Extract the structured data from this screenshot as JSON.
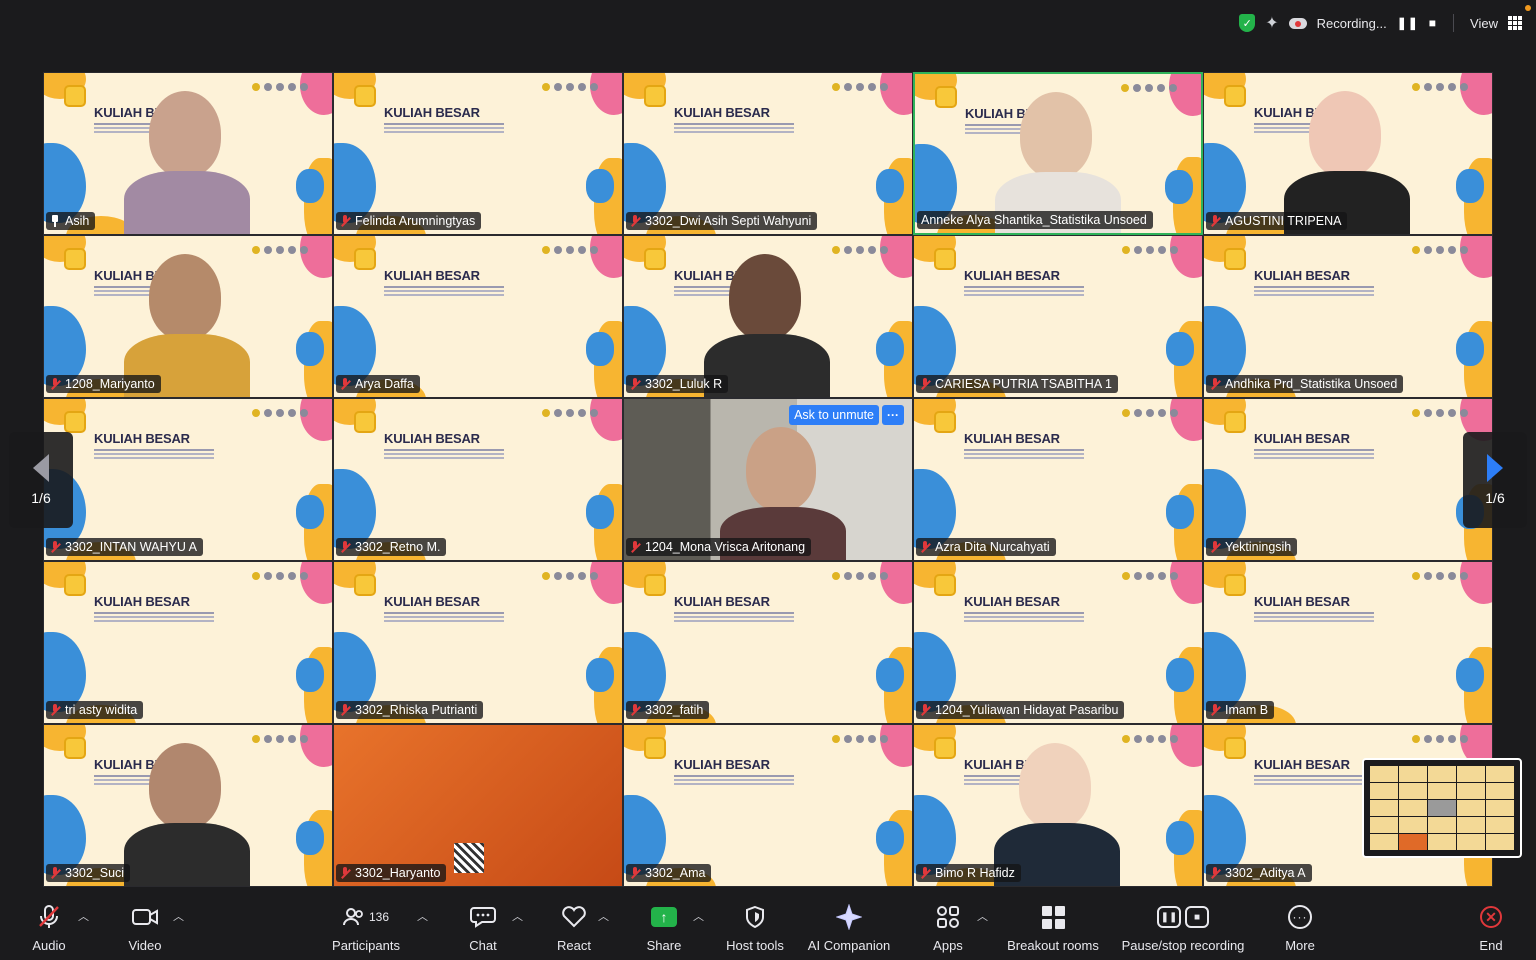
{
  "topbar": {
    "recording_label": "Recording...",
    "view_label": "View"
  },
  "participants": [
    {
      "name": "Asih",
      "icon": "pin-icon"
    },
    {
      "name": "Felinda Arumningtyas",
      "icon": "mic-muted-icon"
    },
    {
      "name": "3302_Dwi Asih Septi Wahyuni",
      "icon": "mic-muted-icon"
    },
    {
      "name": "Anneke Alya Shantika_Statistika Unsoed",
      "icon": "none"
    },
    {
      "name": "AGUSTINI TRIPENA",
      "icon": "mic-muted-icon"
    },
    {
      "name": "1208_Mariyanto",
      "icon": "mic-muted-icon"
    },
    {
      "name": "Arya Daffa",
      "icon": "mic-muted-icon"
    },
    {
      "name": "3302_Luluk R",
      "icon": "mic-muted-icon"
    },
    {
      "name": "CARIESA PUTRIA TSABITHA 1",
      "icon": "mic-muted-icon"
    },
    {
      "name": "Andhika Prd_Statistika Unsoed",
      "icon": "mic-muted-icon"
    },
    {
      "name": "3302_INTAN WAHYU A",
      "icon": "mic-muted-icon"
    },
    {
      "name": "3302_Retno M.",
      "icon": "mic-muted-icon"
    },
    {
      "name": "1204_Mona Vrisca Aritonang",
      "icon": "mic-muted-icon"
    },
    {
      "name": "Azra Dita Nurcahyati",
      "icon": "mic-muted-icon"
    },
    {
      "name": "Yektiningsih",
      "icon": "mic-muted-icon"
    },
    {
      "name": "tri asty widita",
      "icon": "mic-muted-icon"
    },
    {
      "name": "3302_Rhiska Putrianti",
      "icon": "mic-muted-icon"
    },
    {
      "name": "3302_fatih",
      "icon": "mic-muted-icon"
    },
    {
      "name": "1204_Yuliawan Hidayat Pasaribu",
      "icon": "mic-muted-icon"
    },
    {
      "name": "Imam B",
      "icon": "mic-muted-icon"
    },
    {
      "name": "3302_Suci",
      "icon": "mic-muted-icon"
    },
    {
      "name": "3302_Haryanto",
      "icon": "mic-muted-icon"
    },
    {
      "name": "3302_Ama",
      "icon": "mic-muted-icon"
    },
    {
      "name": "Bimo R Hafidz",
      "icon": "mic-muted-icon"
    },
    {
      "name": "3302_Aditya A",
      "icon": "mic-muted-icon"
    }
  ],
  "slide_title": "KULIAH BESAR",
  "ask_to_unmute": "Ask to unmute",
  "more_dots": "···",
  "pager": {
    "left": "1/6",
    "right": "1/6"
  },
  "toolbar": {
    "audio": "Audio",
    "video": "Video",
    "participants": "Participants",
    "participants_count": "136",
    "chat": "Chat",
    "react": "React",
    "share": "Share",
    "host_tools": "Host tools",
    "ai_companion": "AI Companion",
    "apps": "Apps",
    "breakout_rooms": "Breakout rooms",
    "pause_stop_recording": "Pause/stop recording",
    "more": "More",
    "end": "End"
  },
  "colors": {
    "active_speaker_border": "#2fb35a",
    "ask_unmute": "#2d7ef7",
    "muted_red": "#e0383b",
    "share_green": "#23b34a"
  }
}
